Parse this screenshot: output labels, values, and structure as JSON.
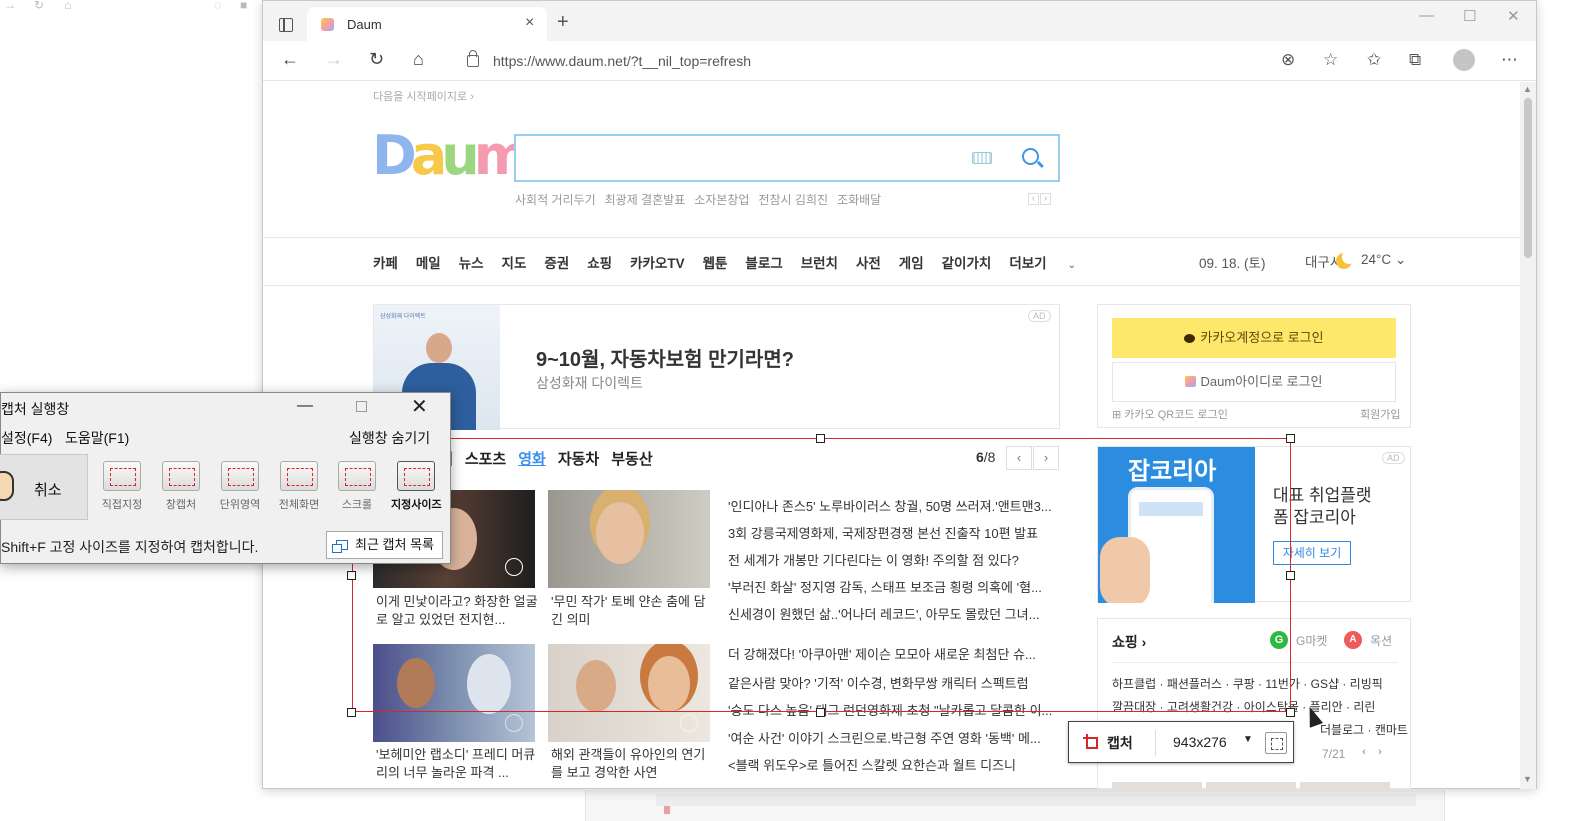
{
  "browser": {
    "tab_title": "Daum",
    "url": "https://www.daum.net/?t__nil_top=refresh"
  },
  "daum": {
    "start_link": "다음을 시작페이지로 ›",
    "logo": [
      "D",
      "a",
      "u",
      "m"
    ],
    "trends": [
      "사회적 거리두기",
      "최광제 결혼발표",
      "소자본창업",
      "전참시 김희진",
      "조화배달"
    ],
    "nav": [
      "카페",
      "메일",
      "뉴스",
      "지도",
      "증권",
      "쇼핑",
      "카카오TV",
      "웹툰",
      "블로그",
      "브런치",
      "사전",
      "게임",
      "같이가치",
      "더보기"
    ],
    "date": "09. 18. (토)",
    "city": "대구시",
    "temp": "24°C",
    "ad": {
      "title": "9~10월, 자동차보험 만기라면?",
      "subtitle": "삼성화재 다이렉트",
      "badge": "AD",
      "photo_caption": "삼성화재 다이렉트"
    },
    "login": {
      "kakao": "카카오계정으로 로그인",
      "daum": "Daum아이디로 로그인",
      "qr": "카카오 QR코드 로그인",
      "join": "회원가입"
    },
    "news_tabs": [
      "예",
      "스포츠",
      "영화",
      "자동차",
      "부동산"
    ],
    "news_tab_active": "영화",
    "pager_current": "6",
    "pager_total": "/8",
    "thumb_captions": [
      "이게 민낯이라고? 화장한 얼굴로 알고 있었던 전지현...",
      "'무민 작가' 토베 얀손 춤에 담긴 의미",
      "'보헤미안 랩소디' 프레디 머큐리의 너무 놀라운 파격 ...",
      "해외 관객들이 유아인의 연기를 보고 경악한 사연"
    ],
    "headlines": [
      "'인디아나 존스5' 노루바이러스 창궐, 50명 쓰러져.'앤트맨3...",
      "3회 강릉국제영화제, 국제장편경쟁 본선 진출작 10편 발표",
      "전 세계가 개봉만 기다린다는 이 영화! 주의할 점 있다?",
      "'부러진 화살' 정지영 감독, 스태프 보조금 횡령 의혹에 '혐...",
      "신세경이 원했던 삶..'어나더 레코드', 아무도 몰랐던 그녀...",
      "더 강해졌다! '아쿠아맨' 제이슨 모모아 새로운 최첨단 슈...",
      "같은사람 맞아? '기적' 이수경, 변화무쌍 캐릭터 스펙트럼",
      "'승도 다스 높음' 태그 런던영화제 초청 \"날카롭고 달콤한 이...",
      "'여순 사건' 이야기 스크린으로.박근형 주연 영화 '동백' 메...",
      "<블랙 위도우>로 틀어진 스칼렛 요한슨과 월트 디즈니"
    ],
    "ad2": {
      "brand": "잡코리아",
      "title_line1": "대표 취업플랫",
      "title_line2": "폼 잡코리아",
      "button": "자세히 보기",
      "badge": "AD"
    },
    "shopping": {
      "title": "쇼핑 ›",
      "gmarket_icon": "G",
      "gmarket": "G마켓",
      "auction_icon": "A",
      "auction": "옥션",
      "line1": "하프클럽 · 패션플러스 · 쿠팡 · 11번가 · GS샵 · 리빙픽",
      "line2": "깔끔대장 · 고려생활건강 · 아이스탐몰 · 플리안 · 리린",
      "line3": "더블로그 · 캔마트",
      "pager": "7/21"
    }
  },
  "capture": {
    "label": "캡처",
    "size": "943x276"
  },
  "launcher": {
    "title": "캡처 실행창",
    "menu_settings": "설정(F4)",
    "menu_help": "도움말(F1)",
    "menu_hide": "실행창 숨기기",
    "cancel": "취소",
    "tools": [
      "직접지정",
      "창캡처",
      "단위영역",
      "전체화면",
      "스크롤",
      "지정사이즈"
    ],
    "status": "Shift+F 고정 사이즈를 지정하여 캡처합니다.",
    "recent": "최근 캡처 목록"
  }
}
